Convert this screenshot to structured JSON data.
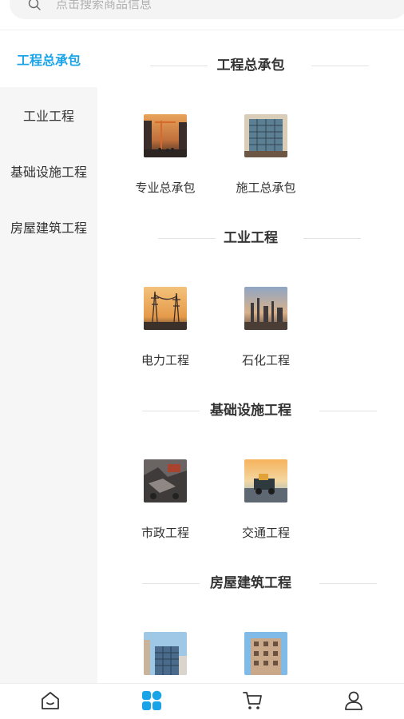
{
  "search": {
    "placeholder": "点击搜索商品信息"
  },
  "sidebar": {
    "items": [
      {
        "label": "工程总承包",
        "active": true
      },
      {
        "label": "工业工程",
        "active": false
      },
      {
        "label": "基础设施工程",
        "active": false
      },
      {
        "label": "房屋建筑工程",
        "active": false
      }
    ]
  },
  "sections": [
    {
      "title": "工程总承包",
      "items": [
        {
          "label": "专业总承包"
        },
        {
          "label": "施工总承包"
        }
      ]
    },
    {
      "title": "工业工程",
      "items": [
        {
          "label": "电力工程"
        },
        {
          "label": "石化工程"
        }
      ]
    },
    {
      "title": "基础设施工程",
      "items": [
        {
          "label": "市政工程"
        },
        {
          "label": "交通工程"
        }
      ]
    },
    {
      "title": "房屋建筑工程",
      "items": [
        {
          "label": ""
        },
        {
          "label": ""
        }
      ]
    }
  ],
  "tabbar": {
    "tabs": [
      {
        "icon": "home-icon",
        "active": false
      },
      {
        "icon": "category-icon",
        "active": true
      },
      {
        "icon": "cart-icon",
        "active": false
      },
      {
        "icon": "user-icon",
        "active": false
      }
    ]
  },
  "colors": {
    "accent": "#1aa4e8",
    "text": "#333333",
    "sidebar_bg": "#f6f6f6"
  }
}
